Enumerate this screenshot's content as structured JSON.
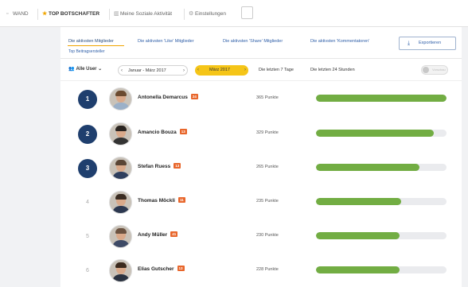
{
  "topnav": {
    "tabs": [
      {
        "label": "WAND",
        "icon": "square-icon",
        "active": false
      },
      {
        "label": "TOP BOTSCHAFTER",
        "icon": "star-icon",
        "active": true
      },
      {
        "label": "Meine Soziale Aktivität",
        "icon": "chart-icon",
        "active": false
      },
      {
        "label": "Einstellungen",
        "icon": "gear-icon",
        "active": false
      }
    ]
  },
  "subtabs": {
    "items": [
      {
        "label": "Die aktivsten Mitglieder",
        "active": true
      },
      {
        "label": "Die aktivsten 'Like' Mitglieder",
        "active": false
      },
      {
        "label": "Die aktivsten 'Share' Mitglieder",
        "active": false
      },
      {
        "label": "Die aktivsten 'Kommentatoren'",
        "active": false
      }
    ],
    "extra": "Top Beitragsersteller",
    "export_label": "Exportieren"
  },
  "filters": {
    "user_filter": "Alle User",
    "range_label": "Januar - März 2017",
    "month_label": "März 2017",
    "last_7_days": "Die letzten 7 Tage",
    "last_24_hours": "Die letzten 24 Stunden",
    "toggle_label": "Vorschau"
  },
  "leaderboard": [
    {
      "rank": "1",
      "highlight": true,
      "name": "Antonella Demarcus",
      "badge": "24",
      "points": "365 Punkte",
      "progress": 1.0,
      "hair": "#6b4a2f",
      "shirt": "#9bb0c8"
    },
    {
      "rank": "2",
      "highlight": true,
      "name": "Amancio Bouza",
      "badge": "13",
      "points": "329 Punkte",
      "progress": 0.9,
      "hair": "#2a2420",
      "shirt": "#333333"
    },
    {
      "rank": "3",
      "highlight": true,
      "name": "Stefan Ruess",
      "badge": "13",
      "points": "265 Punkte",
      "progress": 0.79,
      "hair": "#5a4535",
      "shirt": "#2f3f5e"
    },
    {
      "rank": "4",
      "highlight": false,
      "name": "Thomas Möckli",
      "badge": "11",
      "points": "235 Punkte",
      "progress": 0.65,
      "hair": "#3a2c22",
      "shirt": "#2c3850"
    },
    {
      "rank": "5",
      "highlight": false,
      "name": "Andy Müller",
      "badge": "41",
      "points": "230 Punkte",
      "progress": 0.64,
      "hair": "#6b5240",
      "shirt": "#3e4a66"
    },
    {
      "rank": "6",
      "highlight": false,
      "name": "Elias Gutscher",
      "badge": "13",
      "points": "228 Punkte",
      "progress": 0.64,
      "hair": "#3b2a1e",
      "shirt": "#2a3240"
    }
  ],
  "colors": {
    "accent": "#f5c518",
    "rank_circle": "#1f3f6e",
    "progress": "#72ad43",
    "badge": "#e8662b"
  }
}
